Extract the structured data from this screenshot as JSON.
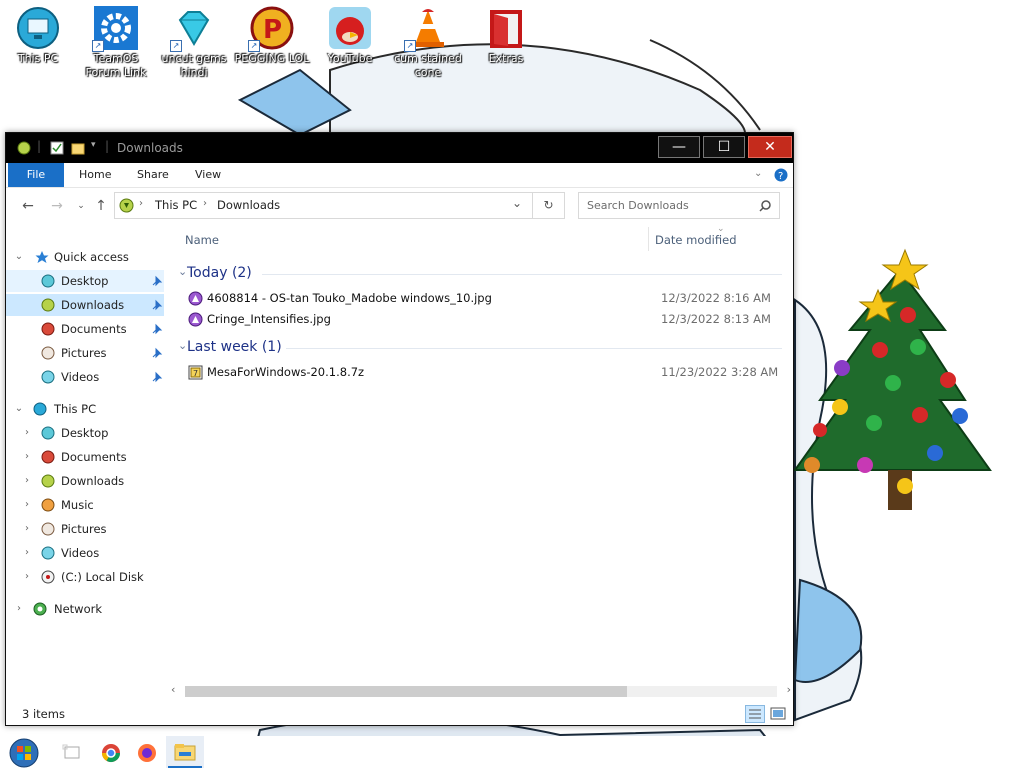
{
  "desktop": {
    "icons": [
      {
        "label": "This PC",
        "icon": "computer-icon"
      },
      {
        "label": "TeamOS Forum Link",
        "icon": "gear-icon"
      },
      {
        "label": "uncut gems hindi",
        "icon": "diamond-icon"
      },
      {
        "label": "PEGGING LOL",
        "icon": "p-logo-icon"
      },
      {
        "label": "YouTube",
        "icon": "angry-bird-icon"
      },
      {
        "label": "cum stained cone",
        "icon": "traffic-cone-icon"
      },
      {
        "label": "Extras",
        "icon": "red-door-icon"
      }
    ]
  },
  "window": {
    "title": "Downloads",
    "ribbon_tabs": [
      "File",
      "Home",
      "Share",
      "View"
    ],
    "address": {
      "crumbs": [
        "This PC",
        "Downloads"
      ]
    },
    "search_placeholder": "Search Downloads",
    "nav": {
      "quick_access_label": "Quick access",
      "quick_access_items": [
        {
          "label": "Desktop",
          "icon": "desktop-icon"
        },
        {
          "label": "Downloads",
          "icon": "downloads-icon"
        },
        {
          "label": "Documents",
          "icon": "documents-icon"
        },
        {
          "label": "Pictures",
          "icon": "pictures-icon"
        },
        {
          "label": "Videos",
          "icon": "videos-icon"
        }
      ],
      "this_pc_label": "This PC",
      "this_pc_items": [
        {
          "label": "Desktop",
          "icon": "desktop-icon"
        },
        {
          "label": "Documents",
          "icon": "documents-icon"
        },
        {
          "label": "Downloads",
          "icon": "downloads-icon"
        },
        {
          "label": "Music",
          "icon": "music-icon"
        },
        {
          "label": "Pictures",
          "icon": "pictures-icon"
        },
        {
          "label": "Videos",
          "icon": "videos-icon"
        },
        {
          "label": "(C:) Local Disk",
          "icon": "disk-icon"
        }
      ],
      "network_label": "Network"
    },
    "columns": {
      "name": "Name",
      "date_modified": "Date modified"
    },
    "groups": [
      {
        "header": "Today (2)",
        "files": [
          {
            "name": "4608814 - OS-tan Touko_Madobe windows_10.jpg",
            "date": "12/3/2022 8:16 AM"
          },
          {
            "name": "Cringe_Intensifies.jpg",
            "date": "12/3/2022 8:13 AM"
          }
        ]
      },
      {
        "header": "Last week (1)",
        "files": [
          {
            "name": "MesaForWindows-20.1.8.7z",
            "date": "11/23/2022 3:28 AM"
          }
        ]
      }
    ],
    "status_text": "3 items"
  },
  "colors": {
    "accent": "#1a6fc7",
    "selection": "#cce8ff",
    "group_header": "#1e3287",
    "close_button": "#c42b1c"
  }
}
